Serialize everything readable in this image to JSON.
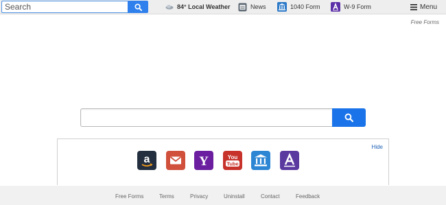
{
  "topbar": {
    "search_placeholder": "Search",
    "weather": "84° Local Weather",
    "news": "News",
    "form_1040": "1040 Form",
    "w9_form": "W-9 Form",
    "menu": "Menu"
  },
  "free_forms_label": "Free Forms",
  "main_search": {
    "value": ""
  },
  "shortcuts": {
    "hide": "Hide",
    "tiles": [
      {
        "icon": "amazon-icon",
        "glyph": "a"
      },
      {
        "icon": "gmail-icon",
        "glyph": "M"
      },
      {
        "icon": "yahoo-icon",
        "glyph": "Y"
      },
      {
        "icon": "youtube-icon",
        "glyph": "You\nTube"
      },
      {
        "icon": "bank-icon",
        "glyph": ""
      },
      {
        "icon": "w9-icon",
        "glyph": "A"
      }
    ]
  },
  "footer": {
    "links": [
      "Free Forms",
      "Terms",
      "Privacy",
      "Uninstall",
      "Contact",
      "Feedback"
    ]
  },
  "colors": {
    "accent": "#2f80ed",
    "topbar_bg": "#eeeeee",
    "footer_bg": "#f1f1f1"
  }
}
